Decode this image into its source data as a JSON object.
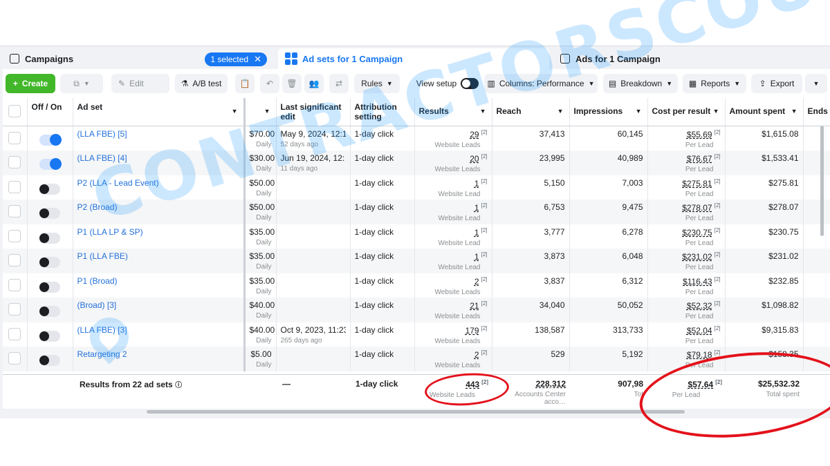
{
  "tabs": {
    "campaigns": {
      "label": "Campaigns",
      "selected_pill": "1 selected"
    },
    "adsets": {
      "label": "Ad sets for 1 Campaign"
    },
    "ads": {
      "label": "Ads for 1 Campaign"
    }
  },
  "toolbar": {
    "create": "Create",
    "edit": "Edit",
    "ab_test": "A/B test",
    "rules": "Rules",
    "view_setup": "View setup",
    "columns": "Columns: Performance",
    "breakdown": "Breakdown",
    "reports": "Reports",
    "export": "Export"
  },
  "columns": {
    "off_on": "Off / On",
    "ad_set": "Ad set",
    "last_edit": "Last significant edit",
    "attribution": "Attribution setting",
    "results": "Results",
    "reach": "Reach",
    "impressions": "Impressions",
    "cost_per_result": "Cost per result",
    "amount_spent": "Amount spent",
    "ends": "Ends"
  },
  "rows": [
    {
      "on": true,
      "name": "(LLA FBE) [5]",
      "budget": "$70.00",
      "budget_type": "Daily",
      "edit": "May 9, 2024, 12:1…",
      "edit_ago": "52 days ago",
      "attribution": "1-day click",
      "results": "29",
      "results_type": "Website Leads",
      "reach": "37,413",
      "impressions": "60,145",
      "cpr": "$55.69",
      "cpr_type": "Per Lead",
      "spent": "$1,615.08"
    },
    {
      "on": true,
      "name": "(LLA FBE) [4]",
      "budget": "$30.00",
      "budget_type": "Daily",
      "edit": "Jun 19, 2024, 12:…",
      "edit_ago": "11 days ago",
      "attribution": "1-day click",
      "results": "20",
      "results_type": "Website Leads",
      "reach": "23,995",
      "impressions": "40,989",
      "cpr": "$76.67",
      "cpr_type": "Per Lead",
      "spent": "$1,533.41"
    },
    {
      "on": false,
      "name": "P2 (LLA - Lead Event)",
      "budget": "$50.00",
      "budget_type": "Daily",
      "edit": "",
      "edit_ago": "",
      "attribution": "1-day click",
      "results": "1",
      "results_type": "Website Lead",
      "reach": "5,150",
      "impressions": "7,003",
      "cpr": "$275.81",
      "cpr_type": "Per Lead",
      "spent": "$275.81"
    },
    {
      "on": false,
      "name": "P2 (Broad)",
      "budget": "$50.00",
      "budget_type": "Daily",
      "edit": "",
      "edit_ago": "",
      "attribution": "1-day click",
      "results": "1",
      "results_type": "Website Lead",
      "reach": "6,753",
      "impressions": "9,475",
      "cpr": "$278.07",
      "cpr_type": "Per Lead",
      "spent": "$278.07"
    },
    {
      "on": false,
      "name": "P1 (LLA LP & SP)",
      "budget": "$35.00",
      "budget_type": "Daily",
      "edit": "",
      "edit_ago": "",
      "attribution": "1-day click",
      "results": "1",
      "results_type": "Website Lead",
      "reach": "3,777",
      "impressions": "6,278",
      "cpr": "$230.75",
      "cpr_type": "Per Lead",
      "spent": "$230.75"
    },
    {
      "on": false,
      "name": "P1 (LLA FBE)",
      "budget": "$35.00",
      "budget_type": "Daily",
      "edit": "",
      "edit_ago": "",
      "attribution": "1-day click",
      "results": "1",
      "results_type": "Website Lead",
      "reach": "3,873",
      "impressions": "6,048",
      "cpr": "$231.02",
      "cpr_type": "Per Lead",
      "spent": "$231.02"
    },
    {
      "on": false,
      "name": "P1 (Broad)",
      "budget": "$35.00",
      "budget_type": "Daily",
      "edit": "",
      "edit_ago": "",
      "attribution": "1-day click",
      "results": "2",
      "results_type": "Website Leads",
      "reach": "3,837",
      "impressions": "6,312",
      "cpr": "$116.43",
      "cpr_type": "Per Lead",
      "spent": "$232.85"
    },
    {
      "on": false,
      "name": "(Broad) [3]",
      "budget": "$40.00",
      "budget_type": "Daily",
      "edit": "",
      "edit_ago": "",
      "attribution": "1-day click",
      "results": "21",
      "results_type": "Website Leads",
      "reach": "34,040",
      "impressions": "50,052",
      "cpr": "$52.32",
      "cpr_type": "Per Lead",
      "spent": "$1,098.82"
    },
    {
      "on": false,
      "name": "(LLA FBE) [3]",
      "budget": "$40.00",
      "budget_type": "Daily",
      "edit": "Oct 9, 2023, 11:23…",
      "edit_ago": "265 days ago",
      "attribution": "1-day click",
      "results": "179",
      "results_type": "Website Leads",
      "reach": "138,587",
      "impressions": "313,733",
      "cpr": "$52.04",
      "cpr_type": "Per Lead",
      "spent": "$9,315.83"
    },
    {
      "on": false,
      "name": "Retargeting 2",
      "budget": "$5.00",
      "budget_type": "Daily",
      "edit": "",
      "edit_ago": "",
      "attribution": "1-day click",
      "results": "2",
      "results_type": "Website Leads",
      "reach": "529",
      "impressions": "5,192",
      "cpr": "$79.18",
      "cpr_type": "Per Lead",
      "spent": "$158.35"
    }
  ],
  "footnote": "[2]",
  "summary": {
    "label": "Results from 22 ad sets",
    "info_icon": "info-icon",
    "last_edit": "—",
    "attribution": "1-day click",
    "results": "443",
    "results_type": "Website Leads",
    "reach": "228,312",
    "reach_type": "Accounts Center acco…",
    "impressions": "907,98",
    "impressions_type": "Tot",
    "cpr": "$57.64",
    "cpr_type": "Per Lead",
    "spent": "$25,532.32",
    "spent_type": "Total spent"
  },
  "watermark": "CONTRACTORSCOUT",
  "colors": {
    "accent": "#1877f2",
    "create": "#42b72a",
    "annotation": "#e3121b",
    "watermark": "#1896ff"
  }
}
